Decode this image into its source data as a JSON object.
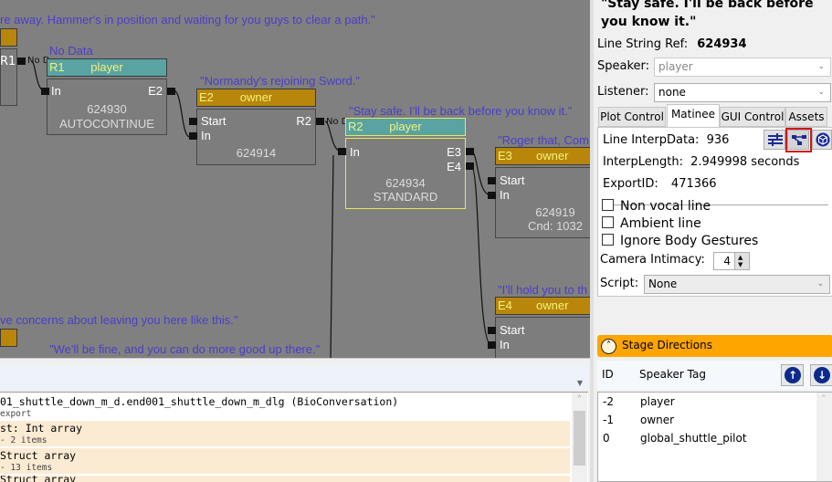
{
  "graph": {
    "comments": [
      "re away. Hammer's in position and waiting for you guys to clear a path.\"",
      "No Data",
      "\"Normandy's rejoining Sword.\"",
      "\"Stay safe. I'll be back before you know it.\"",
      "\"Roger that, Com",
      "\"I'll hold you to th",
      "ve concerns about leaving you here like this.\"",
      "\"We'll be fine, and you can do more good up there.\""
    ],
    "nodes": {
      "r1": {
        "tag": "R1",
        "speaker": "player",
        "pins_in": [
          "In"
        ],
        "pins_out": [
          "E2"
        ],
        "id": "624930",
        "type": "AUTOCONTINUE"
      },
      "e2": {
        "tag": "E2",
        "speaker": "owner",
        "pins_in": [
          "Start",
          "In"
        ],
        "pins_out": [
          "R2"
        ],
        "id": "624914"
      },
      "r2": {
        "tag": "R2",
        "speaker": "player",
        "pins_in": [
          "In"
        ],
        "pins_out": [
          "E3",
          "E4"
        ],
        "id": "624934",
        "type": "STANDARD"
      },
      "e3": {
        "tag": "E3",
        "speaker": "owner",
        "pins_in": [
          "Start",
          "In"
        ],
        "id": "624919",
        "cond": "Cnd: 1032"
      },
      "e4": {
        "tag": "E4",
        "speaker": "owner",
        "pins_in": [
          "Start",
          "In"
        ]
      },
      "left_out": "R1"
    },
    "no_data_label": "No D"
  },
  "bottom": {
    "tree": [
      {
        "title": "01_shuttle_down_m_d.end001_shuttle_down_m_dlg (BioConversation)",
        "sub": "export",
        "highlight": false
      },
      {
        "title": "st: Int array",
        "sub": " - 2 items",
        "highlight": true
      },
      {
        "title": " Struct array",
        "sub": " - 13 items",
        "highlight": true
      },
      {
        "title": " Struct array",
        "sub": "",
        "highlight": true
      }
    ]
  },
  "right": {
    "line_text": "\"Stay safe. I'll be back before you know it.\"",
    "line_string_ref_label": "Line String Ref:",
    "line_string_ref": "624934",
    "speaker_label": "Speaker:",
    "speaker_value": "player",
    "listener_label": "Listener:",
    "listener_value": "none",
    "tabs": [
      "Plot Control",
      "Matinee",
      "GUI Control",
      "Assets"
    ],
    "active_tab": "Matinee",
    "matinee": {
      "interp_data_label": "Line InterpData:",
      "interp_data": "936",
      "interp_length_label": "InterpLength:",
      "interp_length": "2.949998 seconds",
      "export_id_label": "ExportID:",
      "export_id": "471366",
      "checkboxes": [
        {
          "label": "Non vocal line",
          "checked": false
        },
        {
          "label": "Ambient line",
          "checked": false
        },
        {
          "label": "Ignore Body Gestures",
          "checked": false
        }
      ],
      "camera_intimacy_label": "Camera Intimacy:",
      "camera_intimacy": "4",
      "script_label": "Script:",
      "script_value": "None",
      "toolbar_icons": [
        "sliders-icon",
        "node-graph-icon",
        "cube-icon"
      ]
    },
    "stage_directions": {
      "title": "Stage Directions",
      "col_id": "ID",
      "col_tag": "Speaker Tag",
      "rows": [
        {
          "id": "-2",
          "tag": "player"
        },
        {
          "id": "-1",
          "tag": "owner"
        },
        {
          "id": "0",
          "tag": "global_shuttle_pilot"
        }
      ]
    }
  }
}
